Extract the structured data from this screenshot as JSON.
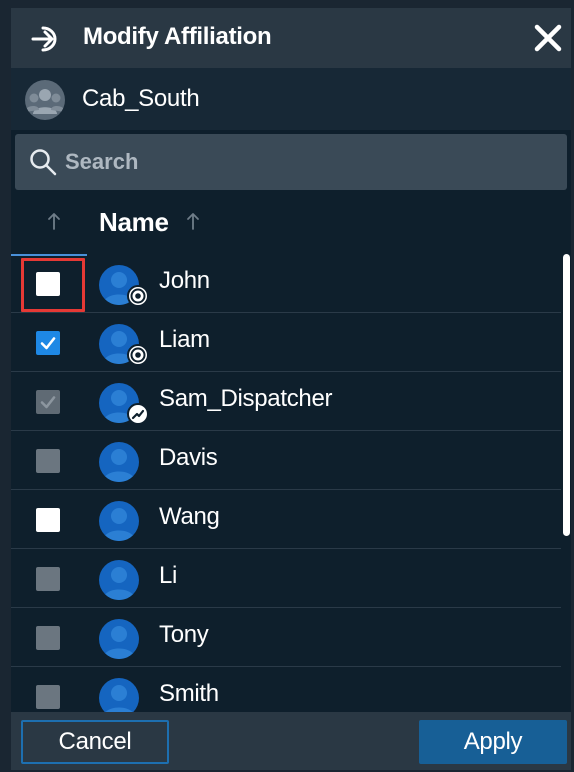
{
  "header": {
    "title": "Modify Affiliation",
    "icon": "sign-in-icon",
    "close_icon": "close-icon"
  },
  "group": {
    "name": "Cab_South",
    "icon": "group-icon"
  },
  "search": {
    "placeholder": "Search",
    "value": ""
  },
  "columns": {
    "name_label": "Name"
  },
  "users": [
    {
      "name": "John",
      "state": "unchecked",
      "badge": "radio-badge"
    },
    {
      "name": "Liam",
      "state": "checked",
      "badge": "radio-badge"
    },
    {
      "name": "Sam_Dispatcher",
      "state": "disabled-checked",
      "badge": "link-badge"
    },
    {
      "name": "Davis",
      "state": "disabled",
      "badge": ""
    },
    {
      "name": "Wang",
      "state": "unchecked",
      "badge": ""
    },
    {
      "name": "Li",
      "state": "disabled",
      "badge": ""
    },
    {
      "name": "Tony",
      "state": "disabled",
      "badge": ""
    },
    {
      "name": "Smith",
      "state": "disabled",
      "badge": ""
    }
  ],
  "footer": {
    "cancel_label": "Cancel",
    "apply_label": "Apply"
  },
  "colors": {
    "accent": "#1e88e5",
    "avatar": "#1565c0",
    "header_bg": "#2a3844",
    "panel_bg": "#0e1f2c",
    "highlight": "#e53935"
  }
}
